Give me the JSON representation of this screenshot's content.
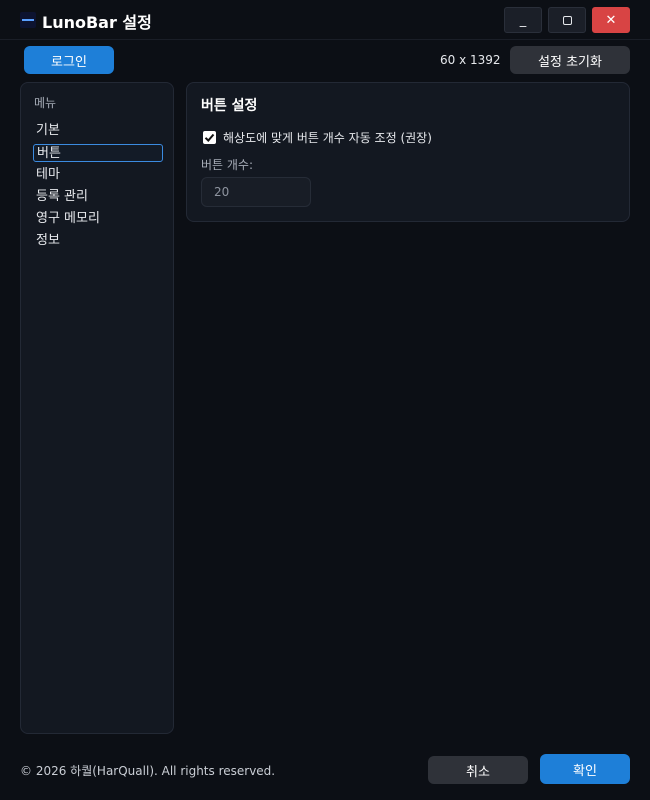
{
  "window": {
    "title": "LunoBar 설정",
    "minimize_label": "_",
    "close_label": "✕"
  },
  "header": {
    "login_label": "로그인",
    "resolution": "60 x 1392",
    "reset_label": "설정 초기화"
  },
  "sidebar": {
    "heading": "메뉴",
    "items": [
      {
        "label": "기본"
      },
      {
        "label": "버튼",
        "active": true
      },
      {
        "label": "테마"
      },
      {
        "label": "등록 관리"
      },
      {
        "label": "영구 메모리"
      },
      {
        "label": "정보"
      }
    ]
  },
  "panel": {
    "title": "버튼 설정",
    "auto_adjust_label": "해상도에 맞게 버튼 개수 자동 조정 (권장)",
    "auto_adjust_checked": true,
    "count_label": "버튼 개수:",
    "count_value": "20"
  },
  "footer": {
    "copyright": "© 2026 하퀄(HarQuall). All rights reserved.",
    "cancel_label": "취소",
    "ok_label": "확인"
  },
  "colors": {
    "accent": "#1e7fd8",
    "close": "#d84444",
    "background": "#0c0f15"
  }
}
